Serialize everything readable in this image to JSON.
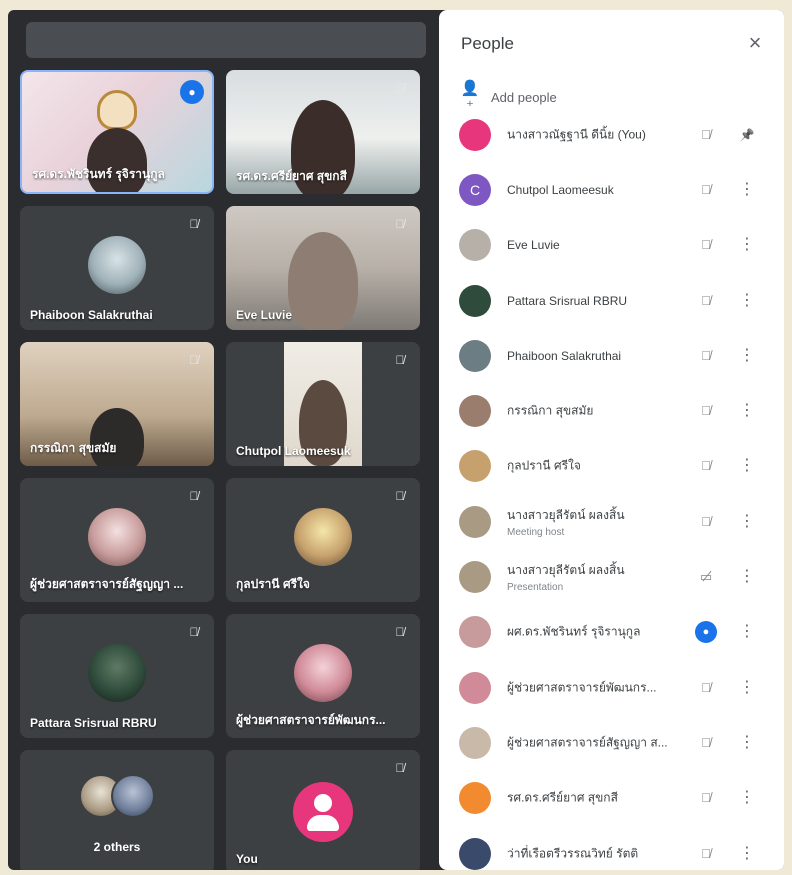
{
  "colors": {
    "background": "#2b2c30",
    "tile": "#3c4043",
    "accent_blue": "#1a73e8",
    "highlight_border": "#8ab4f8",
    "you_avatar": "#e8367c"
  },
  "grid": {
    "tiles": [
      {
        "name": "รศ.ดร.พัชรินทร์ รุจิรานุกูล",
        "kind": "video",
        "status": "speaking"
      },
      {
        "name": "รศ.ดร.ศรีย์ยาศ สุขกสี",
        "kind": "video",
        "status": "muted"
      },
      {
        "name": "Phaiboon Salakruthai",
        "kind": "avatar",
        "status": "muted"
      },
      {
        "name": "Eve Luvie",
        "kind": "video",
        "status": "muted"
      },
      {
        "name": "กรรณิกา สุขสมัย",
        "kind": "video",
        "status": "muted"
      },
      {
        "name": "Chutpol Laomeesuk",
        "kind": "video",
        "status": "muted"
      },
      {
        "name": "ผู้ช่วยศาสตราจารย์สัฐญญา ...",
        "kind": "avatar",
        "status": "muted"
      },
      {
        "name": "กุลปรานี ศรีใจ",
        "kind": "avatar",
        "status": "muted"
      },
      {
        "name": "Pattara Srisrual RBRU",
        "kind": "avatar",
        "status": "muted"
      },
      {
        "name": "ผู้ช่วยศาสตราจารย์พัฒนกร...",
        "kind": "avatar",
        "status": "muted"
      },
      {
        "name": "2 others",
        "kind": "others",
        "status": ""
      },
      {
        "name": "You",
        "kind": "you",
        "status": "muted"
      }
    ]
  },
  "panel": {
    "title": "People",
    "add_people": "Add people",
    "participants": [
      {
        "name": "นางสาวณัฐฐานี ดีนิ้ย (You)",
        "role": "",
        "status": "muted",
        "action": "pin",
        "avatar": "#e8367c",
        "initial": ""
      },
      {
        "name": "Chutpol Laomeesuk",
        "role": "",
        "status": "muted",
        "action": "more",
        "avatar": "#7e57c2",
        "initial": "C"
      },
      {
        "name": "Eve Luvie",
        "role": "",
        "status": "muted",
        "action": "more",
        "avatar": "#b7b0a8",
        "initial": ""
      },
      {
        "name": "Pattara Srisrual RBRU",
        "role": "",
        "status": "muted",
        "action": "more",
        "avatar": "#2f4b3b",
        "initial": ""
      },
      {
        "name": "Phaiboon Salakruthai",
        "role": "",
        "status": "muted",
        "action": "more",
        "avatar": "#6d7d84",
        "initial": ""
      },
      {
        "name": "กรรณิกา สุขสมัย",
        "role": "",
        "status": "muted",
        "action": "more",
        "avatar": "#9a7d6c",
        "initial": ""
      },
      {
        "name": "กุลปรานี ศรีใจ",
        "role": "",
        "status": "muted",
        "action": "more",
        "avatar": "#c7a16d",
        "initial": ""
      },
      {
        "name": "นางสาวยุลีรัตน์ ผลงสิ้น",
        "role": "Meeting host",
        "status": "muted",
        "action": "more",
        "avatar": "#a99a83",
        "initial": ""
      },
      {
        "name": "นางสาวยุลีรัตน์ ผลงสิ้น",
        "role": "Presentation",
        "status": "presenting",
        "action": "more",
        "avatar": "#a99a83",
        "initial": ""
      },
      {
        "name": "ผศ.ดร.พัชรินทร์ รุจิรานุกูล",
        "role": "",
        "status": "speaking",
        "action": "more",
        "avatar": "#c79b9b",
        "initial": ""
      },
      {
        "name": "ผู้ช่วยศาสตราจารย์พัฒนกร...",
        "role": "",
        "status": "muted",
        "action": "more",
        "avatar": "#d08a98",
        "initial": ""
      },
      {
        "name": "ผู้ช่วยศาสตราจารย์สัฐญญา ส...",
        "role": "",
        "status": "muted",
        "action": "more",
        "avatar": "#c9b9a8",
        "initial": ""
      },
      {
        "name": "รศ.ดร.ศรีย์ยาศ สุขกสี",
        "role": "",
        "status": "muted",
        "action": "more",
        "avatar": "#f28b30",
        "initial": ""
      },
      {
        "name": "ว่าที่เรือตรีวรรณวิทย์ รัตติ",
        "role": "",
        "status": "muted",
        "action": "more",
        "avatar": "#3a4a6b",
        "initial": ""
      }
    ]
  },
  "icons": {
    "close": "close-icon",
    "add_people": "add-person-icon",
    "muted": "mic-off-icon",
    "speaking": "audio-level-icon",
    "presenting": "present-icon",
    "pin": "pin-icon",
    "more": "more-vert-icon"
  }
}
